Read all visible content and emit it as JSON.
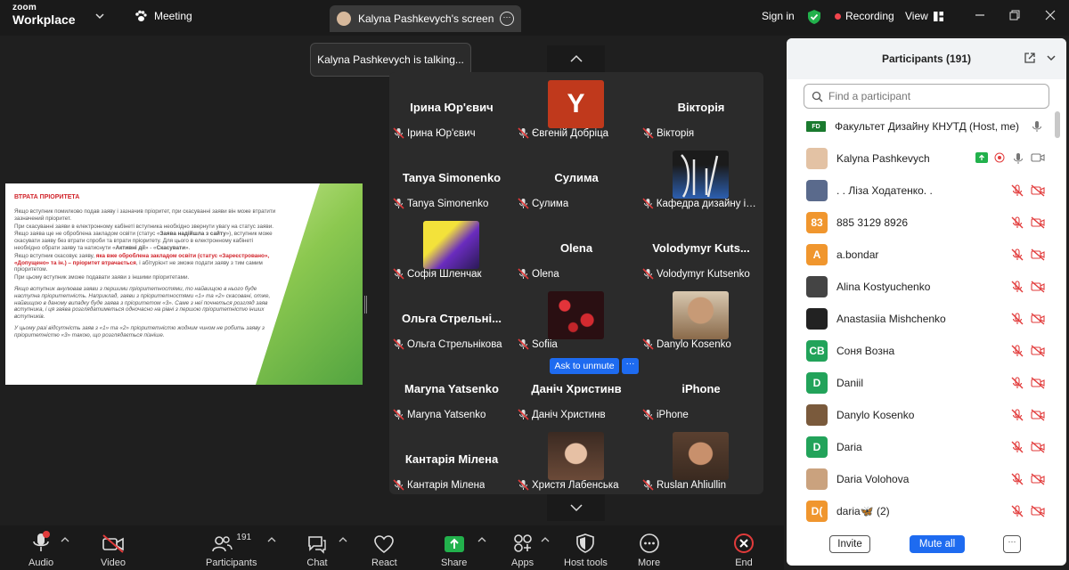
{
  "topbar": {
    "logo_line1": "zoom",
    "logo_line2": "Workplace",
    "meeting": "Meeting",
    "screen_tab": "Kalyna Pashkevych's screen",
    "signin": "Sign in",
    "recording": "Recording",
    "view": "View"
  },
  "toast": "Kalyna Pashkevych is talking...",
  "slide": {
    "title": "ВТРАТА ПРІОРИТЕТА",
    "p1": "Якщо вступник помилково подав заяву і зазначив пріоритет, при скасуванні заяви він може втратити зазначений пріоритет.",
    "p2": "При скасуванні заяви в електронному кабінеті вступника необхідно звернути увагу на статус заяви.",
    "p3a": "Якщо заява ще не оброблена закладом освіти (статус «",
    "p3b": "Заява надійшла з сайту",
    "p3c": "»), вступник може скасувати заяву без втрати спроби та втрати пріоритету. Для цього в електронному кабінеті необхідно обрати заяву та натиснути «",
    "p3d": "Активні дії",
    "p3e": "» - «",
    "p3f": "Скасувати",
    "p3g": "».",
    "p4a": "Якщо вступник скасовує заяву, ",
    "p4b": "яка вже оброблена закладом освіти (статус «Зареєстровано», «Допущено» та ін.) – пріоритет втрачається",
    "p4c": ", і абітурієнт не зможе подати заяву з тим самим пріоритетом.",
    "p5": "При цьому вступник зможе подавати заяви з іншими пріоритетами.",
    "p6": "Якщо вступник анулював заяви з першими пріоритетностями, то найвищою в нього буде наступна пріоритетність. Наприклад, заяви з пріоритетностями «1» та «2» скасовані, отже, найвищою в даному випадку буде заява з пріоритетом «3». Саме з неї почнеться розгляд заяв вступника, і ця заява розглядатиметься одночасно на рівні з першою пріоритетністю інших вступників.",
    "p7": "У цьому разі відсутність заяв з «1» та «2» пріоритетністю жодним чином не робить заяву з пріоритетністю «3» такою, що розглядається пізніше."
  },
  "gallery": {
    "tiles": [
      {
        "name": "Ірина Юр'євич",
        "label": "Ірина Юр'євич"
      },
      {
        "name": "",
        "label": "Євгеній Добріца",
        "avatar_letter": "Y"
      },
      {
        "name": "Вікторія",
        "label": "Вікторія"
      },
      {
        "name": "Tanya Simonenko",
        "label": "Tanya Simonenko"
      },
      {
        "name": "Сулима",
        "label": "Сулима"
      },
      {
        "name": "",
        "label": "Кафедра дизайну інт..."
      },
      {
        "name": "",
        "label": "Софія Шленчак"
      },
      {
        "name": "Olena",
        "label": "Olena"
      },
      {
        "name": "Volodymyr  Kuts...",
        "label": "Volodymyr Kutsenko"
      },
      {
        "name": "Ольга  Стрельні...",
        "label": "Ольга Стрельнікова"
      },
      {
        "name": "",
        "label": "Sofiia"
      },
      {
        "name": "",
        "label": "Danylo Kosenko"
      },
      {
        "name": "Maryna Yatsenko",
        "label": "Maryna Yatsenko"
      },
      {
        "name": "Даніч Христинв",
        "label": "Даніч Христинв"
      },
      {
        "name": "iPhone",
        "label": "iPhone"
      },
      {
        "name": "Кантарія Мілена",
        "label": "Кантарія Мілена"
      },
      {
        "name": "",
        "label": "Христя Лабенська"
      },
      {
        "name": "",
        "label": "Ruslan Ahliullin"
      }
    ],
    "ask_to_unmute": "Ask to unmute",
    "more": "···"
  },
  "participants": {
    "title": "Participants (191)",
    "search_placeholder": "Find a participant",
    "rows": [
      {
        "name": "Факультет Дизайну КНУТД (Host, me)",
        "avatar": "FD",
        "color": "#1a7a2e"
      },
      {
        "name": "Kalyna Pashkevych",
        "avatar": "",
        "color": "#e3c2a4"
      },
      {
        "name": ". . Ліза Ходатенко. .",
        "avatar": "",
        "color": "#5a6a8c"
      },
      {
        "name": "885 3129 8926",
        "avatar": "83",
        "color": "#f0962e"
      },
      {
        "name": "a.bondar",
        "avatar": "A",
        "color": "#f0962e"
      },
      {
        "name": "Alina Kostyuchenko",
        "avatar": "",
        "color": "#444"
      },
      {
        "name": "Anastasiia Mishchenko",
        "avatar": "",
        "color": "#222"
      },
      {
        "name": "Соня Возна",
        "avatar": "CB",
        "color": "#22a35a"
      },
      {
        "name": "Daniil",
        "avatar": "D",
        "color": "#22a35a"
      },
      {
        "name": "Danylo Kosenko",
        "avatar": "",
        "color": "#7a5a3c"
      },
      {
        "name": "Daria",
        "avatar": "D",
        "color": "#22a35a"
      },
      {
        "name": "Daria Volohova",
        "avatar": "",
        "color": "#caa27e"
      },
      {
        "name": "daria🦋 (2)",
        "avatar": "D(",
        "color": "#f0962e"
      }
    ],
    "invite": "Invite",
    "mute_all": "Mute all",
    "more": "···"
  },
  "toolbar": {
    "audio": "Audio",
    "video": "Video",
    "participants": "Participants",
    "participants_count": "191",
    "chat": "Chat",
    "react": "React",
    "share": "Share",
    "apps": "Apps",
    "host_tools": "Host tools",
    "more": "More",
    "end": "End"
  },
  "colors": {
    "accent": "#1e6bf0",
    "share": "#22b14c",
    "end": "#e23b3b",
    "recording": "#f2454d"
  }
}
